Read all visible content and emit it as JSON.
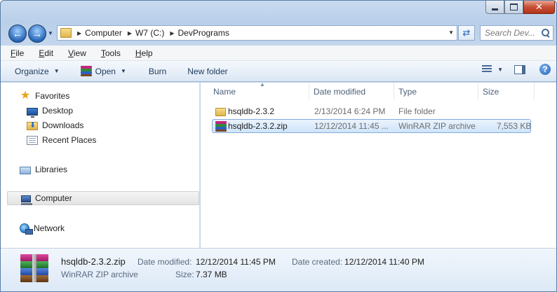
{
  "breadcrumb": [
    "Computer",
    "W7 (C:)",
    "DevPrograms"
  ],
  "search": {
    "placeholder": "Search Dev..."
  },
  "menu": [
    "File",
    "Edit",
    "View",
    "Tools",
    "Help"
  ],
  "menu_shortcuts": [
    "F",
    "E",
    "V",
    "T",
    "H"
  ],
  "toolbar": {
    "organize": "Organize",
    "open": "Open",
    "burn": "Burn",
    "new_folder": "New folder"
  },
  "nav": {
    "favorites": "Favorites",
    "desktop": "Desktop",
    "downloads": "Downloads",
    "recent_places": "Recent Places",
    "libraries": "Libraries",
    "computer": "Computer",
    "network": "Network"
  },
  "columns": {
    "name": "Name",
    "date_modified": "Date modified",
    "type": "Type",
    "size": "Size"
  },
  "files": [
    {
      "name": "hsqldb-2.3.2",
      "date": "2/13/2014 6:24 PM",
      "type": "File folder",
      "size": "",
      "icon": "folder-icon"
    },
    {
      "name": "hsqldb-2.3.2.zip",
      "date": "12/12/2014 11:45 ...",
      "type": "WinRAR ZIP archive",
      "size": "7,553 KB",
      "icon": "winrar-zip-icon"
    }
  ],
  "details": {
    "name": "hsqldb-2.3.2.zip",
    "type": "WinRAR ZIP archive",
    "date_modified_label": "Date modified:",
    "date_modified": "12/12/2014 11:45 PM",
    "date_created_label": "Date created:",
    "date_created": "12/12/2014 11:40 PM",
    "size_label": "Size:",
    "size": "7.37 MB"
  },
  "colors": {
    "accent": "#2866b8",
    "selection": "#cfe4fa",
    "close": "#c74f35"
  }
}
